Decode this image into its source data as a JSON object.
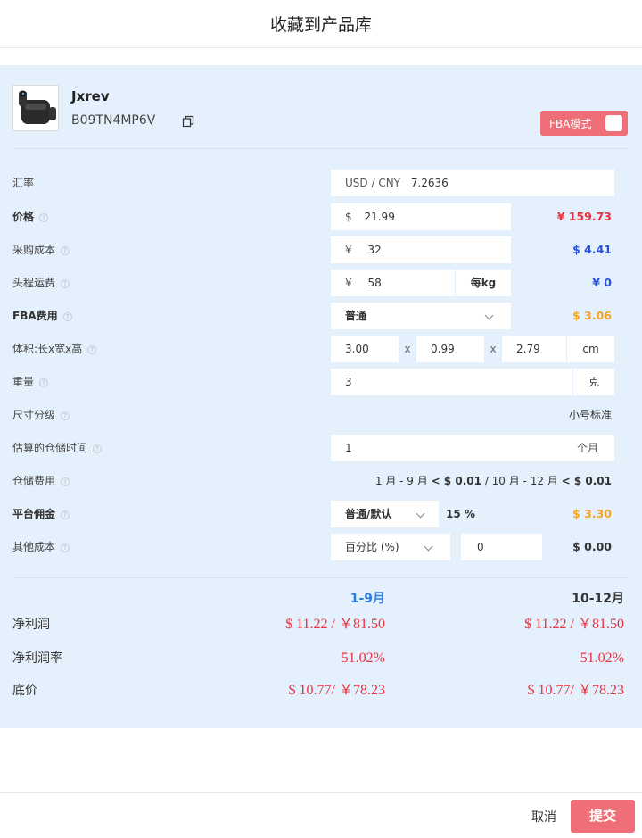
{
  "dialog": {
    "title": "收藏到产品库",
    "cancel_label": "取消",
    "submit_label": "提交"
  },
  "product": {
    "name": "Jxrev",
    "asin": "B09TN4MP6V",
    "fba_label": "FBA模式",
    "thumbnail_icon": "earbuds-image"
  },
  "rows": {
    "rate": {
      "label": "汇率",
      "prefix": "USD / CNY",
      "value": "7.2636"
    },
    "price": {
      "label": "价格",
      "prefix": "$",
      "value": "21.99",
      "result": "¥ 159.73"
    },
    "cost": {
      "label": "采购成本",
      "prefix": "¥",
      "value": "32",
      "result": "$ 4.41"
    },
    "shipping": {
      "label": "头程运费",
      "prefix": "¥",
      "value": "58",
      "unit": "每kg",
      "result": "¥ 0"
    },
    "fba": {
      "label": "FBA费用",
      "value": "普通",
      "result": "$ 3.06"
    },
    "volume": {
      "label": "体积:长x宽x高",
      "l": "3.00",
      "w": "0.99",
      "h": "2.79",
      "x": "x",
      "unit": "cm"
    },
    "weight": {
      "label": "重量",
      "value": "3",
      "unit": "克"
    },
    "size": {
      "label": "尺寸分级",
      "result": "小号标准"
    },
    "storage_time": {
      "label": "估算的仓储时间",
      "value": "1",
      "unit": "个月"
    },
    "storage_fee": {
      "label": "仓储费用",
      "p1": "1 月 - 9 月",
      "v1": "< $ 0.01",
      "sep": "/",
      "p2": "10 月 - 12 月",
      "v2": "< $ 0.01"
    },
    "commission": {
      "label": "平台佣金",
      "value": "普通/默认",
      "pct": "15 %",
      "result": "$ 3.30"
    },
    "other": {
      "label": "其他成本",
      "value": "百分比 (%)",
      "amount": "0",
      "result": "$ 0.00"
    }
  },
  "summary": {
    "col1": "1-9月",
    "col2": "10-12月",
    "profit_label": "净利润",
    "profit1": "$ 11.22 / ￥81.50",
    "profit2": "$ 11.22 / ￥81.50",
    "margin_label": "净利润率",
    "margin1": "51.02%",
    "margin2": "51.02%",
    "floor_label": "底价",
    "floor1": "$ 10.77/ ￥78.23",
    "floor2": "$ 10.77/ ￥78.23"
  },
  "colors": {
    "accent": "#ef6f78",
    "panel": "#e4f0fb",
    "red": "#e8323f",
    "blue": "#2852d8",
    "orange": "#f2a42a"
  }
}
